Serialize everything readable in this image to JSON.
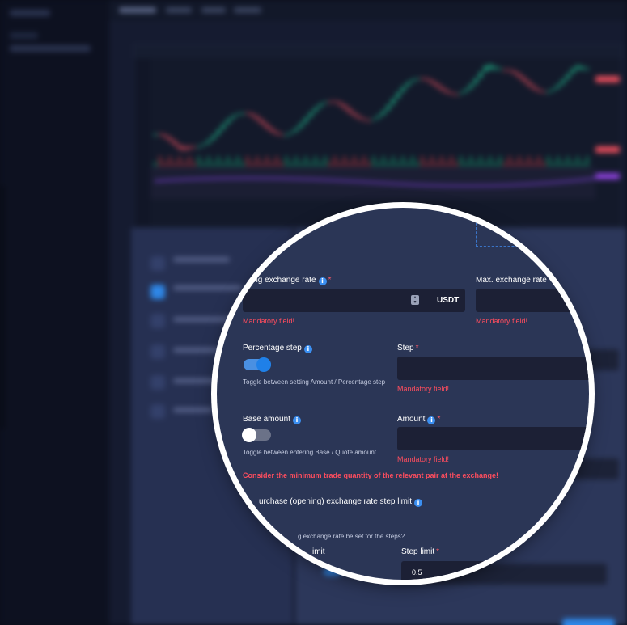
{
  "form": {
    "min_rate": {
      "label": "ing exchange rate",
      "unit": "USDT",
      "error": "Mandatory field!"
    },
    "max_rate": {
      "label": "Max. exchange rate",
      "error": "Mandatory field!"
    },
    "percentage_step": {
      "label": "Percentage step",
      "hint": "Toggle between setting Amount / Percentage step",
      "enabled": true
    },
    "step": {
      "label": "Step",
      "error": "Mandatory field!"
    },
    "base_amount": {
      "label": "Base amount",
      "hint": "Toggle between entering Base / Quote amount",
      "enabled": false
    },
    "amount": {
      "label": "Amount",
      "error": "Mandatory field!"
    },
    "warning": "Consider the minimum trade quantity of the relevant pair at the exchange!",
    "step_limit_section": {
      "title": "urchase (opening) exchange rate step limit",
      "question": "g exchange rate be set for the steps?",
      "left_label": "imit",
      "step_limit_label": "Step limit",
      "step_limit_value": "0.5"
    }
  },
  "icons": {
    "info": "info-icon",
    "spinner": "number-spinner-icon"
  },
  "colors": {
    "background": "#2b3656",
    "input": "#1c2035",
    "accent": "#3b8ff1",
    "error": "#ff4d5e",
    "lens_border": "#ffffff"
  }
}
